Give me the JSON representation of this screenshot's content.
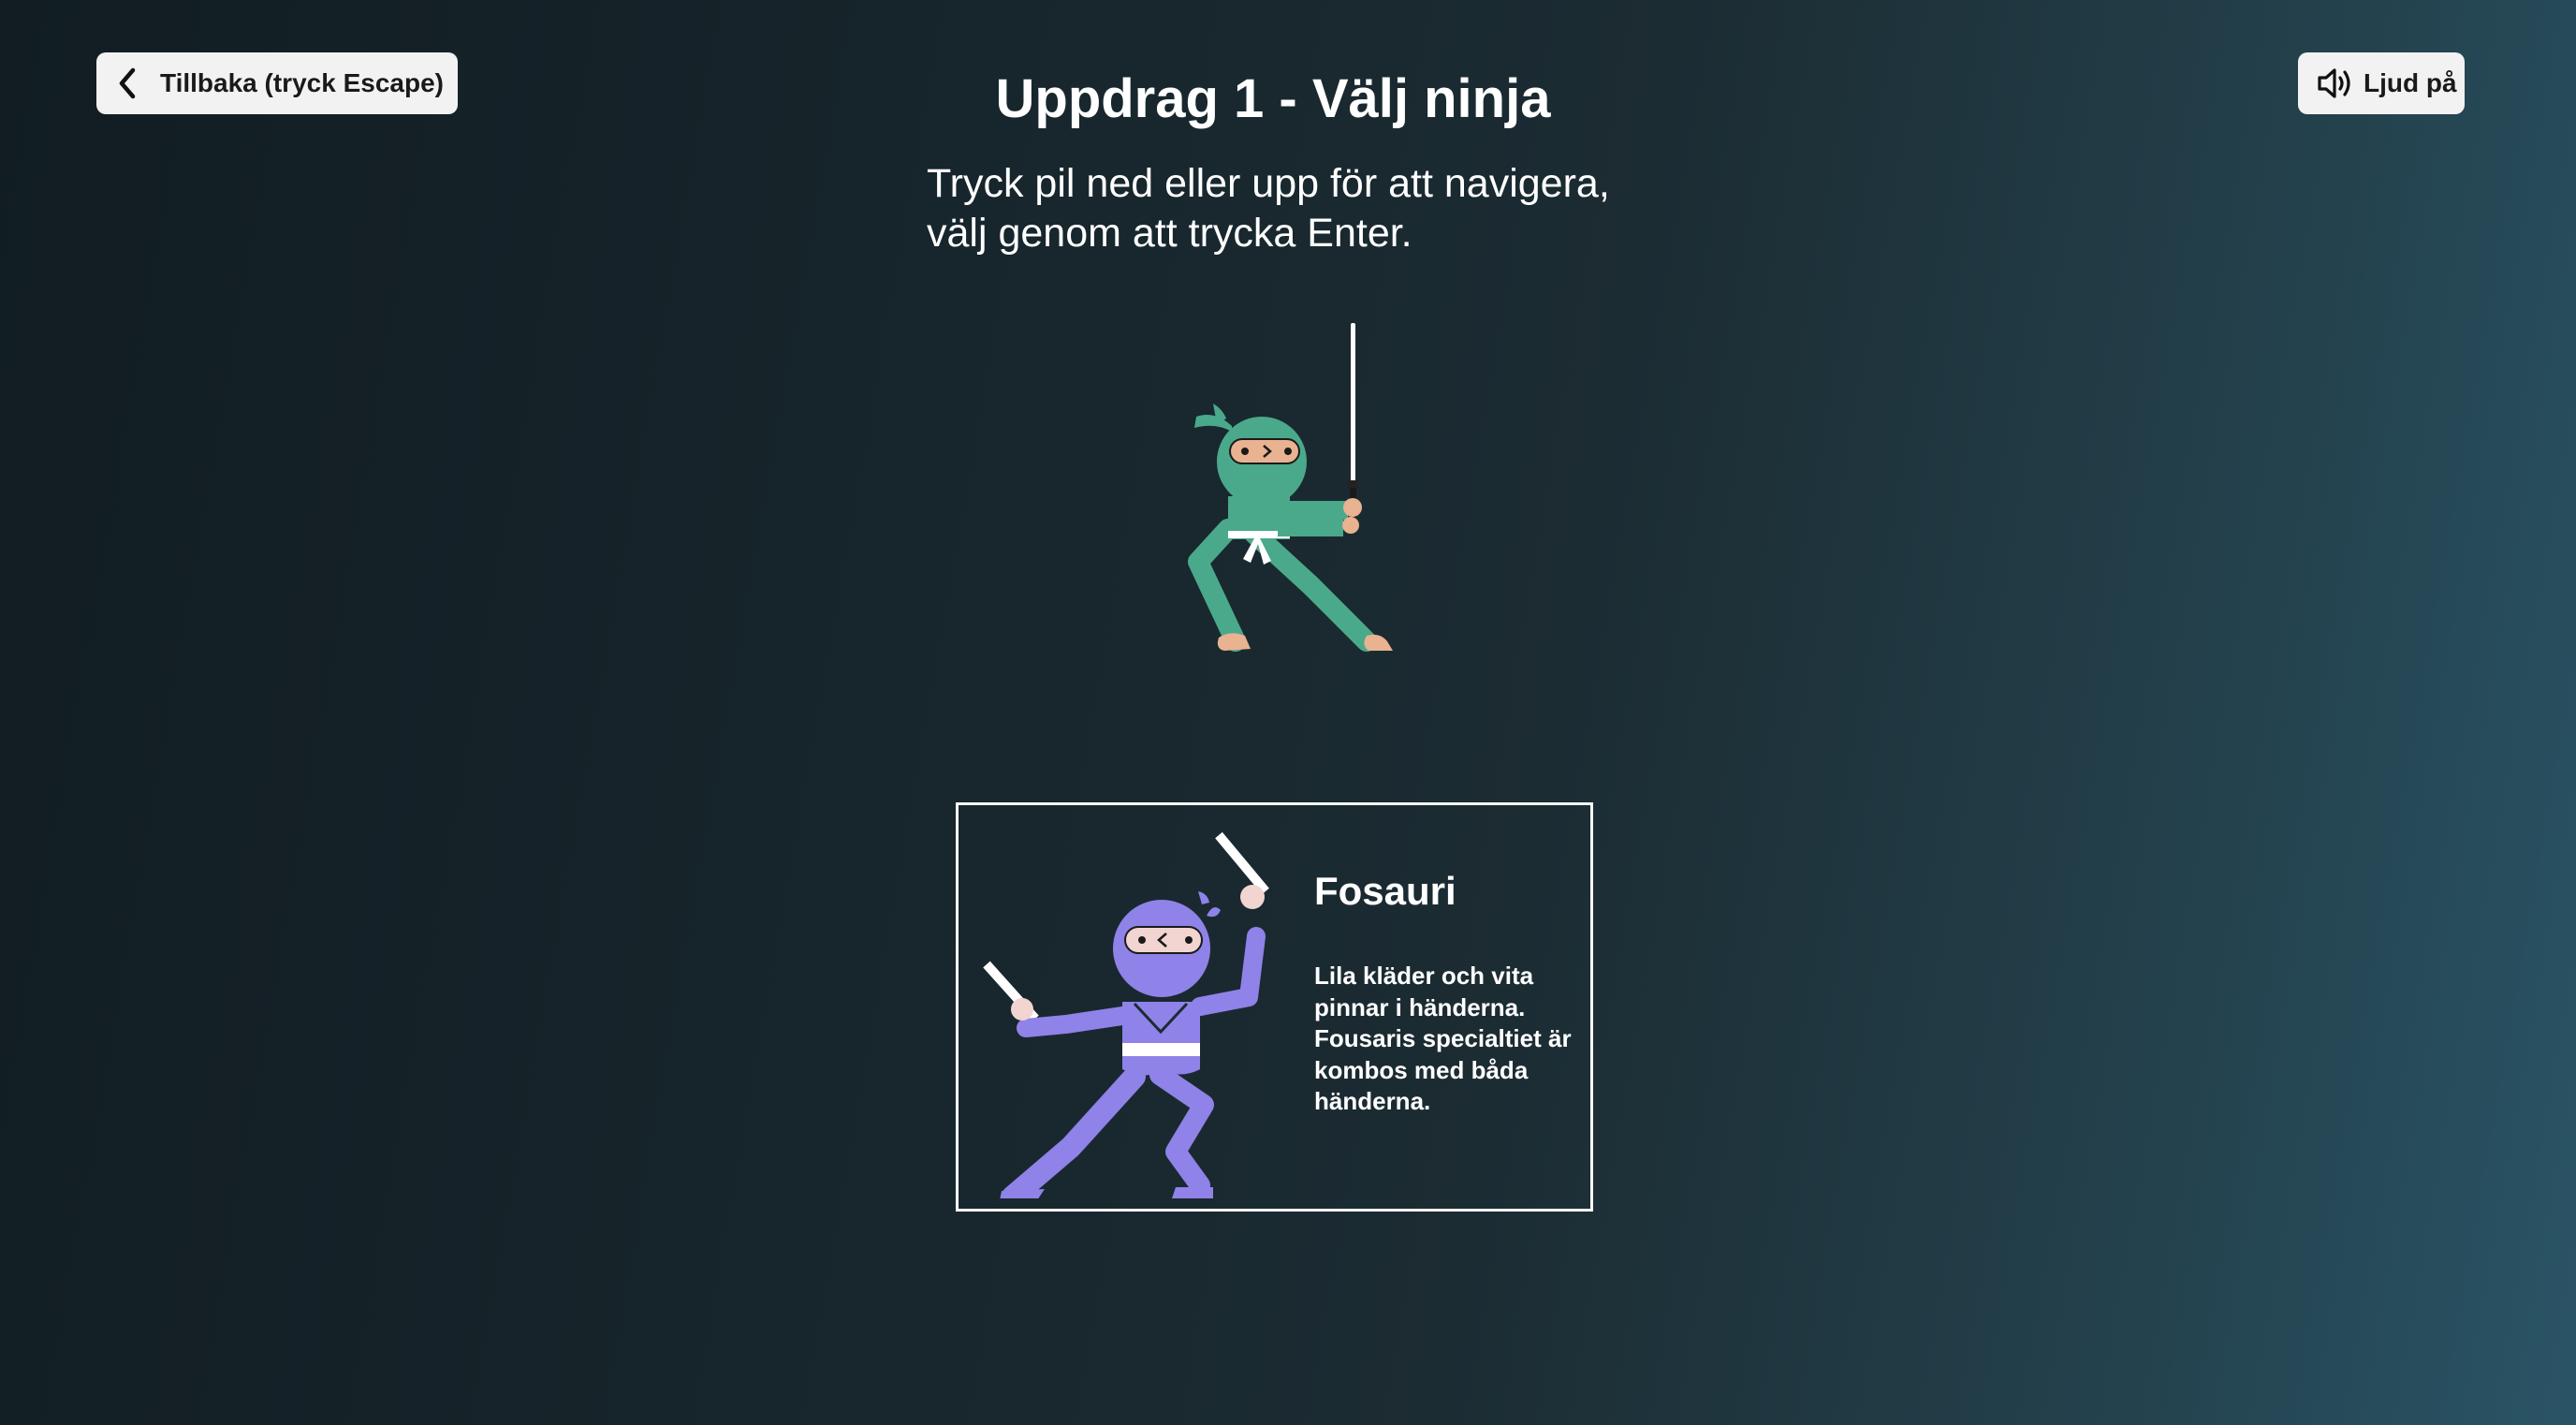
{
  "header": {
    "back_label": "Tillbaka (tryck Escape)",
    "sound_label": "Ljud på",
    "title": "Uppdrag 1 - Välj ninja"
  },
  "instructions": {
    "line1": "Tryck pil ned eller upp för att navigera,",
    "line2": "välj genom att trycka Enter."
  },
  "ninjas": [
    {
      "name": "",
      "color": "#4aa98a",
      "weapon": "katana",
      "selected": false
    },
    {
      "name": "Fosauri",
      "color": "#8f82e8",
      "weapon": "sticks",
      "description": "Lila kläder och vita pinnar i händerna. Fousaris specialtiet är kombos med båda händerna.",
      "selected": true
    }
  ],
  "icons": {
    "back": "chevron-left-icon",
    "sound": "speaker-on-icon"
  },
  "colors": {
    "button_bg": "#f2f2f2",
    "text": "#ffffff",
    "card_border": "#ffffff"
  }
}
